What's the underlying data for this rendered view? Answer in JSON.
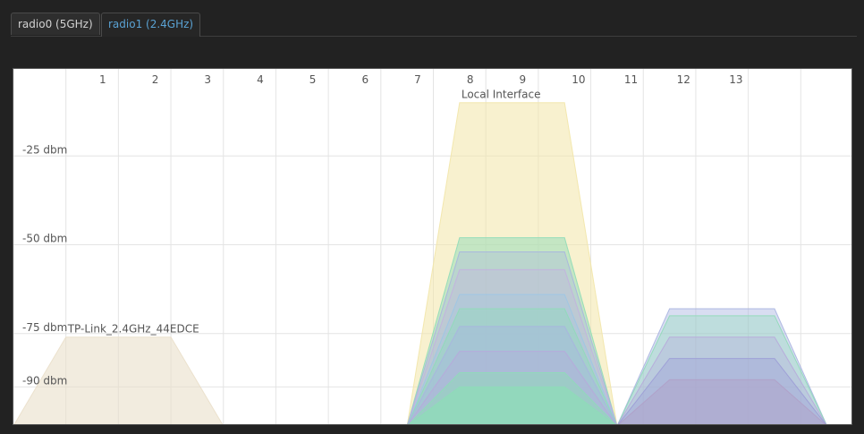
{
  "tabs": [
    {
      "label": "radio0 (5GHz)",
      "active": false
    },
    {
      "label": "radio1 (2.4GHz)",
      "active": true
    }
  ],
  "colors": {
    "active_tab_text": "#5aa2d3",
    "local_interface": "#f2e6a8",
    "tp_link": "#eadfca",
    "green": "#8fdcb8",
    "blue": "#a8b4e0",
    "purple": "#c3b0e0"
  },
  "chart_data": {
    "type": "area",
    "x_ticks": [
      "1",
      "2",
      "3",
      "4",
      "5",
      "6",
      "7",
      "8",
      "9",
      "10",
      "11",
      "12",
      "13"
    ],
    "y_ticks": [
      {
        "value": -25,
        "label": "-25 dbm"
      },
      {
        "value": -50,
        "label": "-50 dbm"
      },
      {
        "value": -75,
        "label": "-75 dbm"
      },
      {
        "value": -90,
        "label": "-90 dbm"
      }
    ],
    "xlim": [
      -0.5,
      15.5
    ],
    "ylim": [
      -101,
      -0.5
    ],
    "grid": true,
    "networks": [
      {
        "name": "Local Interface",
        "center": 9,
        "width": 2,
        "signal": -10,
        "color": "#f2e6a8",
        "opacity": 0.55,
        "label": true
      },
      {
        "name": "TP-Link_2.4GHz_44EDCE",
        "center": 1.5,
        "width": 2,
        "signal": -76,
        "color": "#eadfca",
        "opacity": 0.6,
        "label": true
      },
      {
        "name": "",
        "center": 9,
        "width": 2,
        "signal": -48,
        "color": "#8fdcb8",
        "opacity": 0.5,
        "label": false
      },
      {
        "name": "",
        "center": 9,
        "width": 2,
        "signal": -52,
        "color": "#a8b4e0",
        "opacity": 0.35,
        "label": false
      },
      {
        "name": "",
        "center": 9,
        "width": 2,
        "signal": -57,
        "color": "#c3b0e0",
        "opacity": 0.3,
        "label": false
      },
      {
        "name": "",
        "center": 9,
        "width": 2,
        "signal": -64,
        "color": "#9cc6e6",
        "opacity": 0.3,
        "label": false
      },
      {
        "name": "",
        "center": 9,
        "width": 2,
        "signal": -68,
        "color": "#8fdcb8",
        "opacity": 0.4,
        "label": false
      },
      {
        "name": "",
        "center": 9,
        "width": 2,
        "signal": -73,
        "color": "#a8b4e0",
        "opacity": 0.4,
        "label": false
      },
      {
        "name": "",
        "center": 9,
        "width": 2,
        "signal": -80,
        "color": "#b7a8dc",
        "opacity": 0.35,
        "label": false
      },
      {
        "name": "",
        "center": 9,
        "width": 2,
        "signal": -86,
        "color": "#8fdcb8",
        "opacity": 0.5,
        "label": false
      },
      {
        "name": "",
        "center": 9,
        "width": 2,
        "signal": -90,
        "color": "#8fdcb8",
        "opacity": 0.75,
        "label": false
      },
      {
        "name": "",
        "center": 13,
        "width": 2,
        "signal": -68,
        "color": "#a8b4e0",
        "opacity": 0.45,
        "label": false
      },
      {
        "name": "",
        "center": 13,
        "width": 2,
        "signal": -70,
        "color": "#8fdcb8",
        "opacity": 0.35,
        "label": false
      },
      {
        "name": "",
        "center": 13,
        "width": 2,
        "signal": -76,
        "color": "#b7a8dc",
        "opacity": 0.35,
        "label": false
      },
      {
        "name": "",
        "center": 13,
        "width": 2,
        "signal": -82,
        "color": "#9c9cd6",
        "opacity": 0.35,
        "label": false
      },
      {
        "name": "",
        "center": 13,
        "width": 2,
        "signal": -88,
        "color": "#b0a0c8",
        "opacity": 0.45,
        "label": false
      }
    ]
  }
}
